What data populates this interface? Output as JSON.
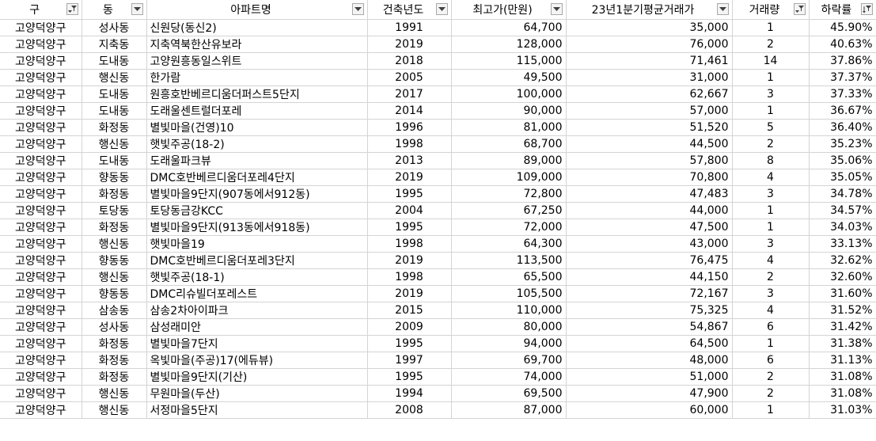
{
  "columns": [
    {
      "label": "구",
      "filter": "filtered"
    },
    {
      "label": "동",
      "filter": "dropdown"
    },
    {
      "label": "아파트명",
      "filter": "dropdown"
    },
    {
      "label": "건축년도",
      "filter": "dropdown"
    },
    {
      "label": "최고가(만원)",
      "filter": "dropdown"
    },
    {
      "label": "23년1분기평균거래가",
      "filter": "dropdown"
    },
    {
      "label": "거래량",
      "filter": "filtered"
    },
    {
      "label": "하락률",
      "filter": "sorted-filtered"
    }
  ],
  "rows": [
    [
      "고양덕양구",
      "성사동",
      "신원당(동신2)",
      "1991",
      "64,700",
      "35,000",
      "1",
      "45.90%"
    ],
    [
      "고양덕양구",
      "지축동",
      "지축역북한산유보라",
      "2019",
      "128,000",
      "76,000",
      "2",
      "40.63%"
    ],
    [
      "고양덕양구",
      "도내동",
      "고양원흥동일스위트",
      "2018",
      "115,000",
      "71,461",
      "14",
      "37.86%"
    ],
    [
      "고양덕양구",
      "행신동",
      "한가람",
      "2005",
      "49,500",
      "31,000",
      "1",
      "37.37%"
    ],
    [
      "고양덕양구",
      "도내동",
      "원흥호반베르디움더퍼스트5단지",
      "2017",
      "100,000",
      "62,667",
      "3",
      "37.33%"
    ],
    [
      "고양덕양구",
      "도내동",
      "도래울센트럴더포레",
      "2014",
      "90,000",
      "57,000",
      "1",
      "36.67%"
    ],
    [
      "고양덕양구",
      "화정동",
      "별빛마을(건영)10",
      "1996",
      "81,000",
      "51,520",
      "5",
      "36.40%"
    ],
    [
      "고양덕양구",
      "행신동",
      "햇빛주공(18-2)",
      "1998",
      "68,700",
      "44,500",
      "2",
      "35.23%"
    ],
    [
      "고양덕양구",
      "도내동",
      "도래울파크뷰",
      "2013",
      "89,000",
      "57,800",
      "8",
      "35.06%"
    ],
    [
      "고양덕양구",
      "향동동",
      "DMC호반베르디움더포레4단지",
      "2019",
      "109,000",
      "70,800",
      "4",
      "35.05%"
    ],
    [
      "고양덕양구",
      "화정동",
      "별빛마을9단지(907동에서912동)",
      "1995",
      "72,800",
      "47,483",
      "3",
      "34.78%"
    ],
    [
      "고양덕양구",
      "토당동",
      "토당동금강KCC",
      "2004",
      "67,250",
      "44,000",
      "1",
      "34.57%"
    ],
    [
      "고양덕양구",
      "화정동",
      "별빛마을9단지(913동에서918동)",
      "1995",
      "72,000",
      "47,500",
      "1",
      "34.03%"
    ],
    [
      "고양덕양구",
      "행신동",
      "햇빛마을19",
      "1998",
      "64,300",
      "43,000",
      "3",
      "33.13%"
    ],
    [
      "고양덕양구",
      "향동동",
      "DMC호반베르디움더포레3단지",
      "2019",
      "113,500",
      "76,475",
      "4",
      "32.62%"
    ],
    [
      "고양덕양구",
      "행신동",
      "햇빛주공(18-1)",
      "1998",
      "65,500",
      "44,150",
      "2",
      "32.60%"
    ],
    [
      "고양덕양구",
      "향동동",
      "DMC리슈빌더포레스트",
      "2019",
      "105,500",
      "72,167",
      "3",
      "31.60%"
    ],
    [
      "고양덕양구",
      "삼송동",
      "삼송2차아이파크",
      "2015",
      "110,000",
      "75,325",
      "4",
      "31.52%"
    ],
    [
      "고양덕양구",
      "성사동",
      "삼성래미안",
      "2009",
      "80,000",
      "54,867",
      "6",
      "31.42%"
    ],
    [
      "고양덕양구",
      "화정동",
      "별빛마을7단지",
      "1995",
      "94,000",
      "64,500",
      "1",
      "31.38%"
    ],
    [
      "고양덕양구",
      "화정동",
      "옥빛마을(주공)17(에듀뷰)",
      "1997",
      "69,700",
      "48,000",
      "6",
      "31.13%"
    ],
    [
      "고양덕양구",
      "화정동",
      "별빛마을9단지(기산)",
      "1995",
      "74,000",
      "51,000",
      "2",
      "31.08%"
    ],
    [
      "고양덕양구",
      "행신동",
      "무원마을(두산)",
      "1994",
      "69,500",
      "47,900",
      "2",
      "31.08%"
    ],
    [
      "고양덕양구",
      "행신동",
      "서정마을5단지",
      "2008",
      "87,000",
      "60,000",
      "1",
      "31.03%"
    ]
  ]
}
